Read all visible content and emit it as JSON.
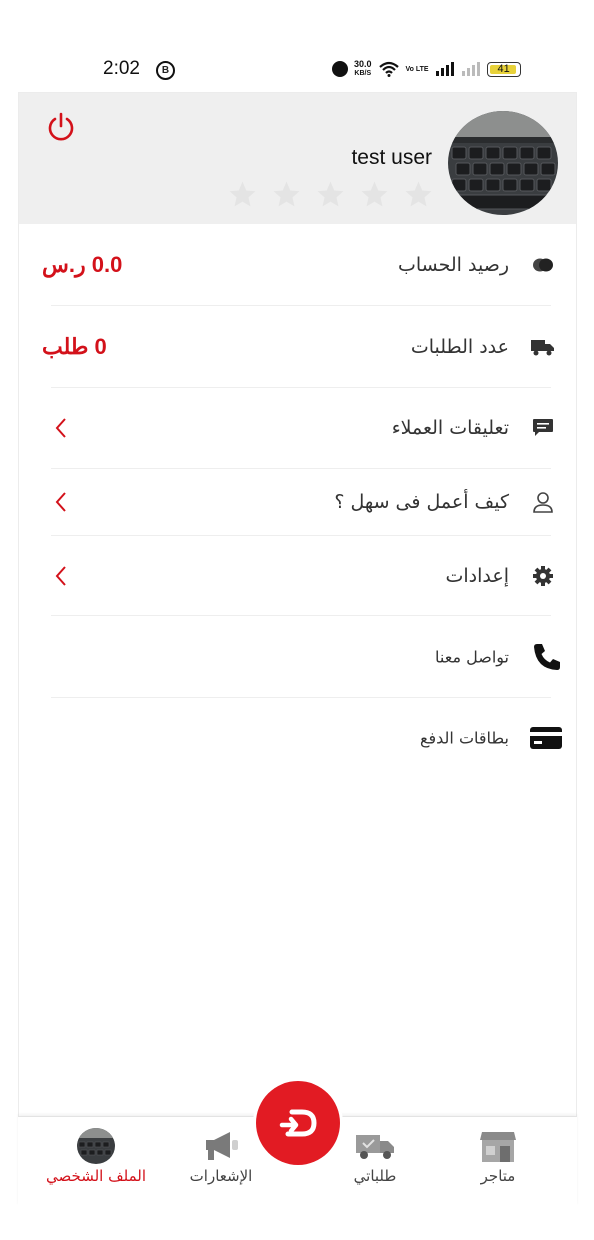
{
  "status_bar": {
    "time": "2:02",
    "b_badge": "B",
    "net_speed_value": "30.0",
    "net_speed_unit": "KB/S",
    "volte": "Vo LTE",
    "battery": "41"
  },
  "profile": {
    "user_name": "test user",
    "rating_stars": 5,
    "rating_filled": 0
  },
  "menu": {
    "balance": {
      "label": "رصيد الحساب",
      "value": "0.0 ر.س"
    },
    "orders": {
      "label": "عدد الطلبات",
      "value": "0 طلب"
    },
    "reviews": {
      "label": "تعليقات العملاء"
    },
    "how_to_work": {
      "label": "كيف أعمل فى سهل ؟"
    },
    "settings": {
      "label": "إعدادات"
    },
    "contact": {
      "label": "تواصل معنا"
    },
    "cards": {
      "label": "بطاقات الدفع"
    }
  },
  "bottom_nav": {
    "profile": "الملف الشخصي",
    "notifications": "الإشعارات",
    "orders": "طلباتي",
    "stores": "متاجر"
  },
  "colors": {
    "accent": "#d3111a",
    "header_bg": "#efefef",
    "star": "#e4e4e4",
    "fab": "#e21b23"
  },
  "icons": {
    "power": "power-icon",
    "balance": "coins-icon",
    "orders": "truck-icon",
    "reviews": "chat-icon",
    "how_to_work": "user-icon",
    "settings": "gear-icon",
    "contact": "phone-icon",
    "cards": "credit-card-icon"
  }
}
